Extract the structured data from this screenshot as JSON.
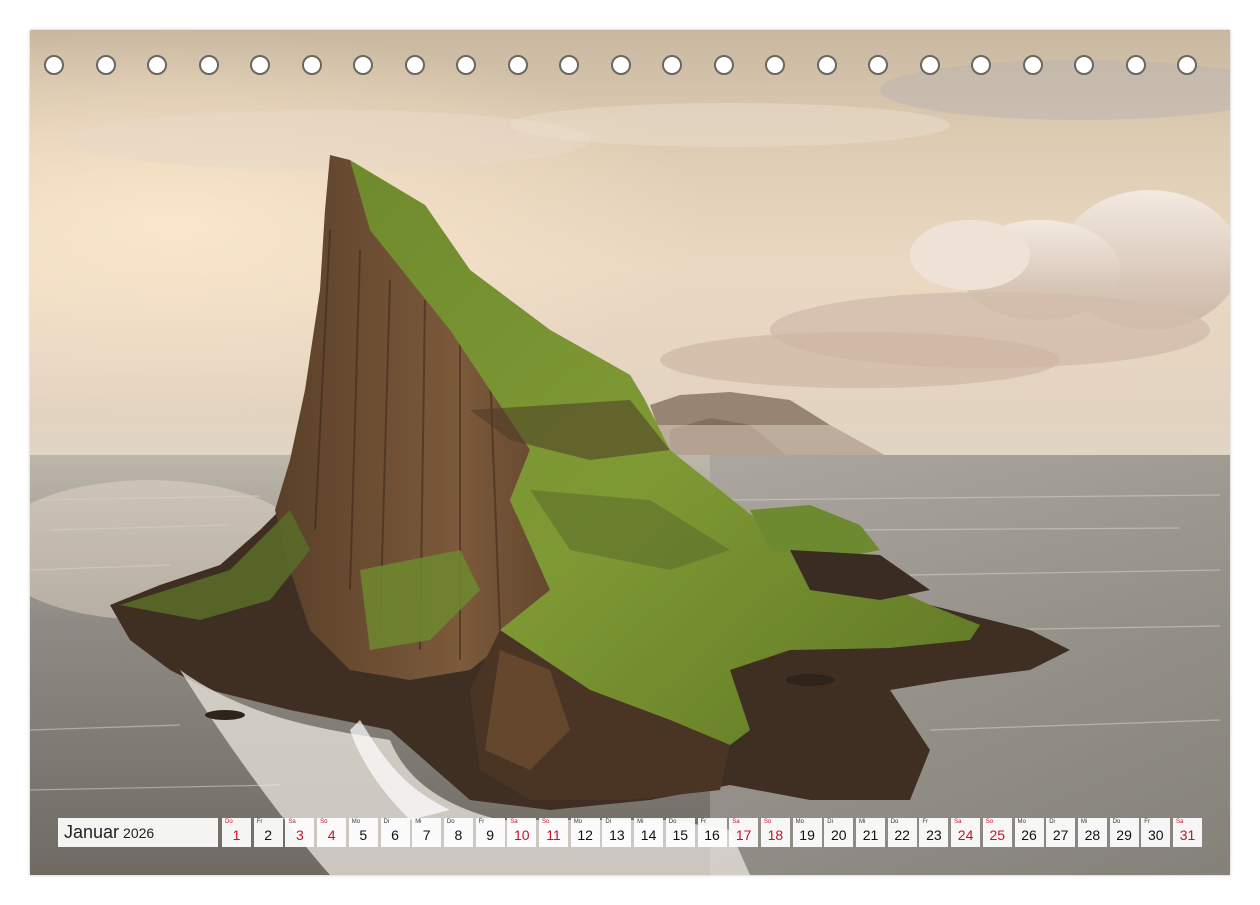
{
  "calendar": {
    "month": "Januar",
    "year": "2026",
    "days": [
      {
        "num": "1",
        "wd": "Do",
        "weekend": true
      },
      {
        "num": "2",
        "wd": "Fr",
        "weekend": false
      },
      {
        "num": "3",
        "wd": "Sa",
        "weekend": true
      },
      {
        "num": "4",
        "wd": "So",
        "weekend": true
      },
      {
        "num": "5",
        "wd": "Mo",
        "weekend": false
      },
      {
        "num": "6",
        "wd": "Di",
        "weekend": false
      },
      {
        "num": "7",
        "wd": "Mi",
        "weekend": false
      },
      {
        "num": "8",
        "wd": "Do",
        "weekend": false
      },
      {
        "num": "9",
        "wd": "Fr",
        "weekend": false
      },
      {
        "num": "10",
        "wd": "Sa",
        "weekend": true
      },
      {
        "num": "11",
        "wd": "So",
        "weekend": true
      },
      {
        "num": "12",
        "wd": "Mo",
        "weekend": false
      },
      {
        "num": "13",
        "wd": "Di",
        "weekend": false
      },
      {
        "num": "14",
        "wd": "Mi",
        "weekend": false
      },
      {
        "num": "15",
        "wd": "Do",
        "weekend": false
      },
      {
        "num": "16",
        "wd": "Fr",
        "weekend": false
      },
      {
        "num": "17",
        "wd": "Sa",
        "weekend": true
      },
      {
        "num": "18",
        "wd": "So",
        "weekend": true
      },
      {
        "num": "19",
        "wd": "Mo",
        "weekend": false
      },
      {
        "num": "20",
        "wd": "Di",
        "weekend": false
      },
      {
        "num": "21",
        "wd": "Mi",
        "weekend": false
      },
      {
        "num": "22",
        "wd": "Do",
        "weekend": false
      },
      {
        "num": "23",
        "wd": "Fr",
        "weekend": false
      },
      {
        "num": "24",
        "wd": "Sa",
        "weekend": true
      },
      {
        "num": "25",
        "wd": "So",
        "weekend": true
      },
      {
        "num": "26",
        "wd": "Mo",
        "weekend": false
      },
      {
        "num": "27",
        "wd": "Di",
        "weekend": false
      },
      {
        "num": "28",
        "wd": "Mi",
        "weekend": false
      },
      {
        "num": "29",
        "wd": "Do",
        "weekend": false
      },
      {
        "num": "30",
        "wd": "Fr",
        "weekend": false
      },
      {
        "num": "31",
        "wd": "Sa",
        "weekend": true
      }
    ],
    "weekend_color": "#c8102e",
    "binding_holes": 23
  },
  "photo": {
    "subject": "sea-stack-cliff-island"
  }
}
